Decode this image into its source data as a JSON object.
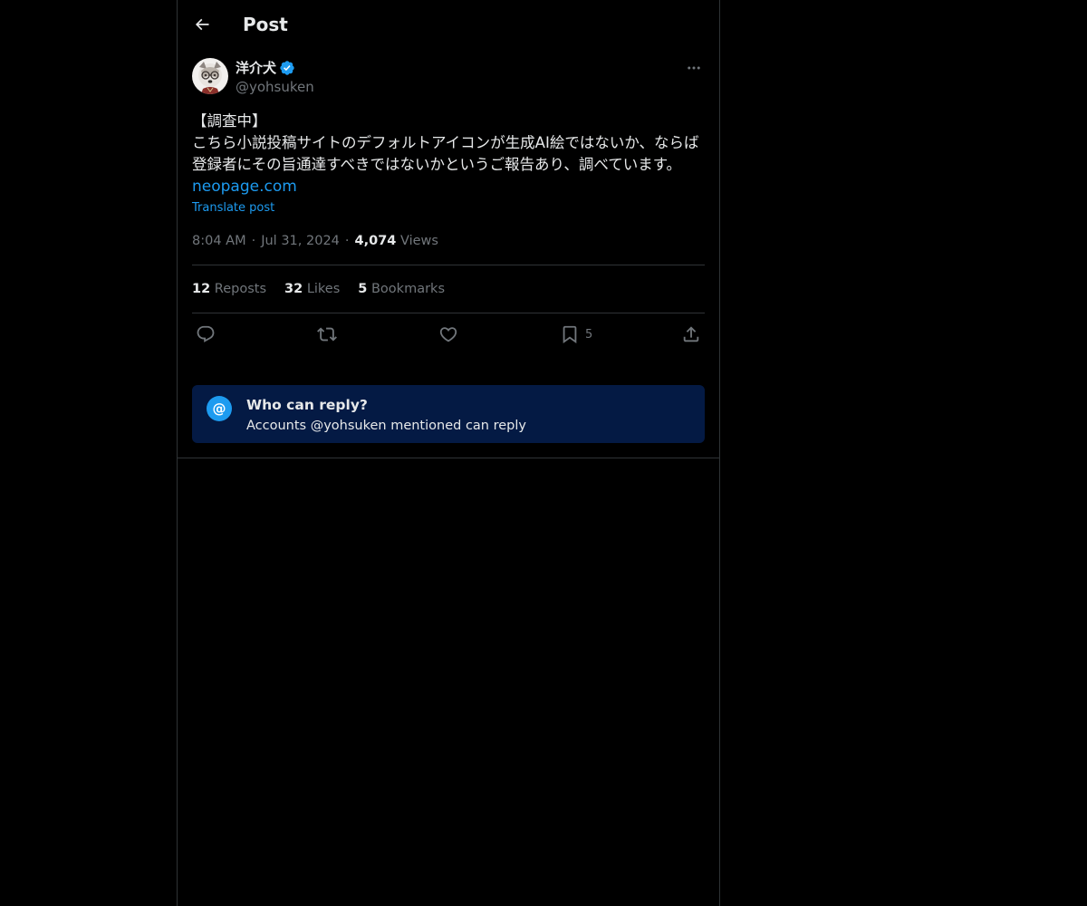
{
  "header": {
    "title": "Post",
    "back_icon": "arrow-left-icon"
  },
  "author": {
    "display_name": "洋介犬",
    "handle": "@yohsuken",
    "verified": true,
    "verified_color": "#1d9bf0"
  },
  "post": {
    "text": "【調査中】\nこちら小説投稿サイトのデフォルトアイコンが生成AI絵ではないか、ならば登録者にその旨通達すべきではないかというご報告あり、調べています。",
    "link": "neopage.com",
    "translate_label": "Translate post",
    "time": "8:04 AM",
    "sep1": "·",
    "date": "Jul 31, 2024",
    "sep2": "·",
    "views_count": "4,074",
    "views_label": "Views"
  },
  "stats": {
    "reposts_count": "12",
    "reposts_label": "Reposts",
    "likes_count": "32",
    "likes_label": "Likes",
    "bookmarks_count": "5",
    "bookmarks_label": "Bookmarks"
  },
  "actions": {
    "bookmark_count": "5",
    "icons": [
      "reply-icon",
      "repost-icon",
      "like-icon",
      "bookmark-icon",
      "share-icon"
    ]
  },
  "reply_restriction": {
    "icon_symbol": "@",
    "title": "Who can reply?",
    "subtitle": "Accounts @yohsuken mentioned can reply"
  },
  "colors": {
    "background": "#000000",
    "text": "#e7e9ea",
    "muted": "#71767b",
    "accent": "#1d9bf0",
    "divider": "#2f3336",
    "reply_box_bg": "#041a44"
  }
}
